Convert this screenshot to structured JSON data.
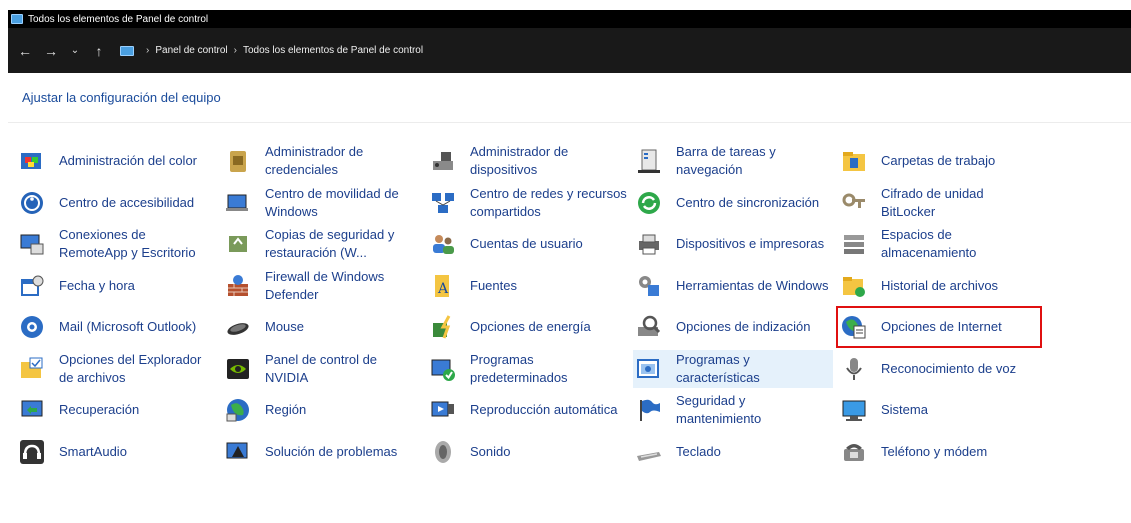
{
  "window": {
    "title": "Todos los elementos de Panel de control"
  },
  "nav": {
    "back": "←",
    "forward": "→",
    "recent": "⌄",
    "up": "↑",
    "breadcrumb": [
      "Panel de control",
      "Todos los elementos de Panel de control"
    ],
    "breadcrumb_sep": "›"
  },
  "heading": "Ajustar la configuración del equipo",
  "items": [
    {
      "label": "Administración del color",
      "icon": "color-management-icon"
    },
    {
      "label": "Administrador de credenciales",
      "icon": "credential-manager-icon"
    },
    {
      "label": "Administrador de dispositivos",
      "icon": "device-manager-icon"
    },
    {
      "label": "Barra de tareas y navegación",
      "icon": "taskbar-icon"
    },
    {
      "label": "Carpetas de trabajo",
      "icon": "work-folders-icon"
    },
    {
      "label": "Centro de accesibilidad",
      "icon": "accessibility-icon"
    },
    {
      "label": "Centro de movilidad de Windows",
      "icon": "mobility-center-icon"
    },
    {
      "label": "Centro de redes y recursos compartidos",
      "icon": "network-center-icon"
    },
    {
      "label": "Centro de sincronización",
      "icon": "sync-center-icon"
    },
    {
      "label": "Cifrado de unidad BitLocker",
      "icon": "bitlocker-icon"
    },
    {
      "label": "Conexiones de RemoteApp y Escritorio",
      "icon": "remoteapp-icon"
    },
    {
      "label": "Copias de seguridad y restauración (W...",
      "icon": "backup-icon"
    },
    {
      "label": "Cuentas de usuario",
      "icon": "user-accounts-icon"
    },
    {
      "label": "Dispositivos e impresoras",
      "icon": "printers-icon"
    },
    {
      "label": "Espacios de almacenamiento",
      "icon": "storage-spaces-icon"
    },
    {
      "label": "Fecha y hora",
      "icon": "date-time-icon"
    },
    {
      "label": "Firewall de Windows Defender",
      "icon": "firewall-icon"
    },
    {
      "label": "Fuentes",
      "icon": "fonts-icon"
    },
    {
      "label": "Herramientas de Windows",
      "icon": "windows-tools-icon"
    },
    {
      "label": "Historial de archivos",
      "icon": "file-history-icon"
    },
    {
      "label": "Mail (Microsoft Outlook)",
      "icon": "mail-icon"
    },
    {
      "label": "Mouse",
      "icon": "mouse-icon"
    },
    {
      "label": "Opciones de energía",
      "icon": "power-options-icon"
    },
    {
      "label": "Opciones de indización",
      "icon": "indexing-icon"
    },
    {
      "label": "Opciones de Internet",
      "icon": "internet-options-icon"
    },
    {
      "label": "Opciones del Explorador de archivos",
      "icon": "explorer-options-icon"
    },
    {
      "label": "Panel de control de NVIDIA",
      "icon": "nvidia-icon"
    },
    {
      "label": "Programas predeterminados",
      "icon": "default-programs-icon"
    },
    {
      "label": "Programas y características",
      "icon": "programs-features-icon"
    },
    {
      "label": "Reconocimiento de voz",
      "icon": "microphone-icon"
    },
    {
      "label": "Recuperación",
      "icon": "recovery-icon"
    },
    {
      "label": "Región",
      "icon": "region-icon"
    },
    {
      "label": "Reproducción automática",
      "icon": "autoplay-icon"
    },
    {
      "label": "Seguridad y mantenimiento",
      "icon": "security-flag-icon"
    },
    {
      "label": "Sistema",
      "icon": "system-icon"
    },
    {
      "label": "SmartAudio",
      "icon": "smartaudio-icon"
    },
    {
      "label": "Solución de problemas",
      "icon": "troubleshooting-icon"
    },
    {
      "label": "Sonido",
      "icon": "sound-icon"
    },
    {
      "label": "Teclado",
      "icon": "keyboard-icon"
    },
    {
      "label": "Teléfono y módem",
      "icon": "phone-modem-icon"
    }
  ],
  "colors": {
    "link": "#1c3f8c",
    "heading": "#1a4b9b",
    "hover": "#e5f1fb",
    "highlight_box": "#e01010"
  }
}
